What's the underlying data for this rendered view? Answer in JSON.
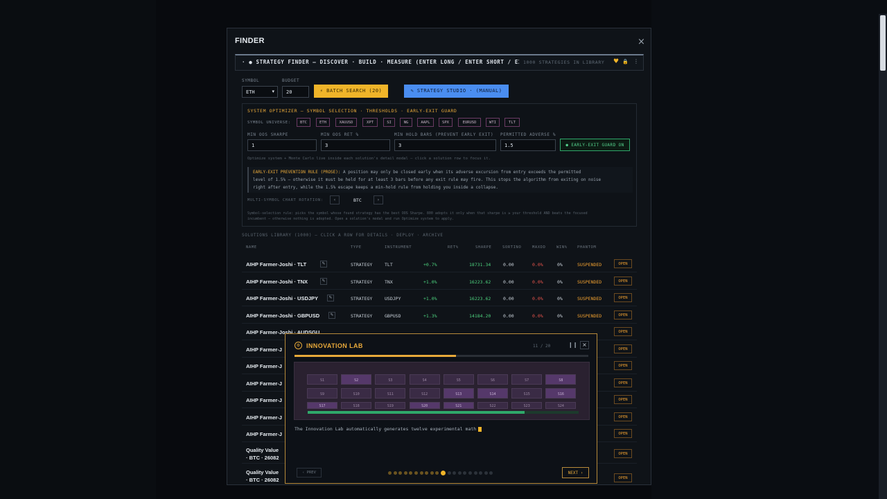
{
  "finder": {
    "title": "FINDER",
    "close_label": "×",
    "topbar": {
      "title": "· ● STRATEGY FINDER — DISCOVER · BUILD · MEASURE (ENTER LONG / ENTER SHORT / EXI…",
      "library_count": "1000 STRATEGIES IN LIBRARY",
      "heart": "♥",
      "lock": "🔒",
      "menu": "⋮"
    },
    "symbol": {
      "label": "SYMBOL",
      "value": "ETH"
    },
    "budget": {
      "label": "BUDGET",
      "value": "20"
    },
    "batch_button": "⚡ BATCH SEARCH (20)",
    "studio_button": "✎ STRATEGY STUDIO · (MANUAL)",
    "optimizer": {
      "title": "SYSTEM OPTIMIZER — SYMBOL SELECTION · THRESHOLDS · EARLY-EXIT GUARD",
      "universe_label": "SYMBOL UNIVERSE:",
      "universe": [
        "BTC",
        "ETH",
        "XAUUSD",
        "XPT",
        "SI",
        "NG",
        "AAPL",
        "SPX",
        "EURUSD",
        "WTI",
        "TLT"
      ],
      "fields": [
        {
          "label": "MIN OOS SHARPE",
          "value": "1"
        },
        {
          "label": "MIN OOS RET %",
          "value": "3"
        },
        {
          "label": "MIN HOLD BARS (PREVENT EARLY EXIT)",
          "value": "3"
        },
        {
          "label": "PERMITTED ADVERSE %",
          "value": "1.5"
        }
      ],
      "guard_button": "● EARLY-EXIT GUARD ON",
      "hint": "Optimize system + Monte Carlo live inside each solution's detail modal — click a solution row to focus it.",
      "rule_label": "EARLY-EXIT PREVENTION RULE (PROSE):",
      "rule_line1": " A position may only be closed early when its adverse excursion from entry exceeds the permitted",
      "rule_line2": "level of 1.5% — otherwise it must be held for at least 3 bars before any exit rule may fire. This stops the algorithm from exiting on noise",
      "rule_line3": "right after entry, while the 1.5% escape keeps a min-hold rule from holding you inside a collapse.",
      "rotation_label": "MULTI-SYMBOL CHART ROTATION:",
      "rotation_prev": "‹",
      "rotation_value": "BTC",
      "rotation_next": "›",
      "selection_line1": "Symbol-selection rule: picks the symbol whose found strategy has the best OOS Sharpe. 800 adopts it only when that sharpe is ≥ your threshold AND beats the focused",
      "selection_line2": "incumbent — otherwise nothing is adopted. Open a solution's modal and run Optimize system to apply."
    },
    "library": {
      "title": "SOLUTIONS LIBRARY (1000) — CLICK A ROW FOR DETAILS · DEPLOY · ARCHIVE",
      "columns": [
        "NAME",
        "TYPE",
        "INSTRUMENT",
        "RET%",
        "SHARPE",
        "SORTINO",
        "MAXDD",
        "WIN%",
        "PHANTOM"
      ],
      "rows": [
        {
          "name": "AIHP Farmer-Joshi · TLT",
          "type": "STRATEGY",
          "instrument": "TLT",
          "ret": "+0.7%",
          "sharpe": "18731.34",
          "sortino": "0.00",
          "maxdd": "0.0%",
          "win": "0%",
          "phantom": "SUSPENDED",
          "action": "OPEN"
        },
        {
          "name": "AIHP Farmer-Joshi · TNX",
          "type": "STRATEGY",
          "instrument": "TNX",
          "ret": "+1.0%",
          "sharpe": "16223.62",
          "sortino": "0.00",
          "maxdd": "0.0%",
          "win": "0%",
          "phantom": "SUSPENDED",
          "action": "OPEN"
        },
        {
          "name": "AIHP Farmer-Joshi · USDJPY",
          "type": "STRATEGY",
          "instrument": "USDJPY",
          "ret": "+1.0%",
          "sharpe": "16223.62",
          "sortino": "0.00",
          "maxdd": "0.0%",
          "win": "0%",
          "phantom": "SUSPENDED",
          "action": "OPEN"
        },
        {
          "name": "AIHP Farmer-Joshi · GBPUSD",
          "type": "STRATEGY",
          "instrument": "GBPUSD",
          "ret": "+1.3%",
          "sharpe": "14184.20",
          "sortino": "0.00",
          "maxdd": "0.0%",
          "win": "0%",
          "phantom": "SUSPENDED",
          "action": "OPEN"
        },
        {
          "name": "AIHP Farmer-Joshi · AUDSGU",
          "action": "OPEN"
        },
        {
          "name": "AIHP Farmer-J",
          "action": "OPEN"
        },
        {
          "name": "AIHP Farmer-J",
          "action": "OPEN"
        },
        {
          "name": "AIHP Farmer-J",
          "action": "OPEN"
        },
        {
          "name": "AIHP Farmer-J",
          "action": "OPEN"
        },
        {
          "name": "AIHP Farmer-J",
          "action": "OPEN"
        },
        {
          "name": "AIHP Farmer-J",
          "action": "OPEN"
        },
        {
          "name": "Quality Value",
          "sub": "· BTC · 26082",
          "action": "OPEN"
        },
        {
          "name": "Quality Value",
          "sub": "· BTC · 26082",
          "action": "OPEN"
        }
      ]
    }
  },
  "lab": {
    "title": "INNOVATION LAB",
    "icon": "⚙",
    "counter": "11 / 20",
    "pause": "❙❙",
    "close": "×",
    "progress": 0.55,
    "grid_progress": 0.8,
    "cells": [
      "S1",
      "S2",
      "S3",
      "S4",
      "S5",
      "S6",
      "S7",
      "S8",
      "S9",
      "S10",
      "S11",
      "S12",
      "S13",
      "S14",
      "S15",
      "S16",
      "S17",
      "S18",
      "S19",
      "S20",
      "S21",
      "S22",
      "S23",
      "S24"
    ],
    "highlighted": [
      1,
      7,
      12,
      13,
      15,
      16,
      19,
      20
    ],
    "description": "The Innovation Lab automatically generates twelve experimental math",
    "prev": "‹ PREV",
    "next": "NEXT ›",
    "steps_total": 20,
    "step_current": 11
  },
  "colors": {
    "accent": "#f0b429",
    "studio": "#4a8df0",
    "positive": "#4cd07d",
    "negative": "#e5534b",
    "suspended": "#f0a030"
  }
}
